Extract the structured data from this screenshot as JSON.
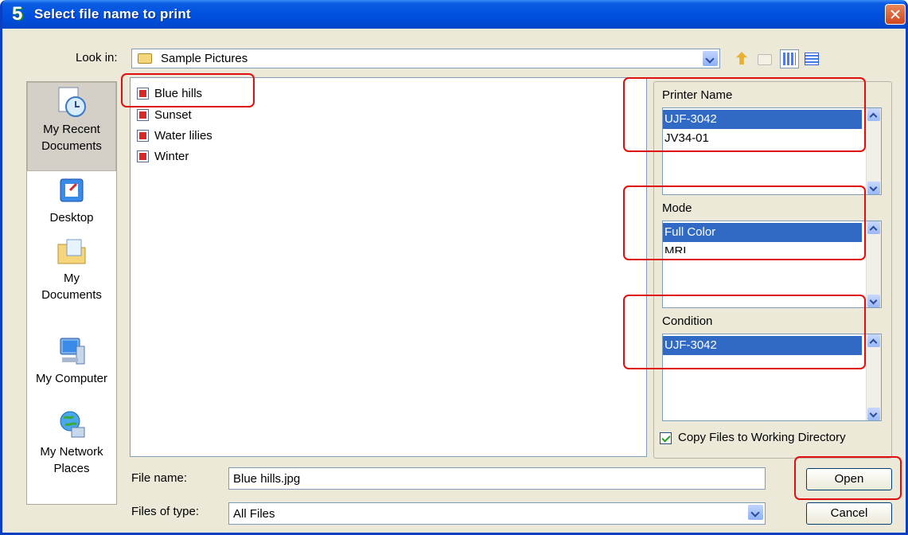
{
  "window": {
    "title": "Select file name to print",
    "app_icon": "5"
  },
  "lookin": {
    "label": "Look in:",
    "value": "Sample Pictures"
  },
  "toolbar": {
    "icons": [
      "up-folder-icon",
      "new-folder-icon",
      "list-view-icon",
      "details-view-icon"
    ]
  },
  "places": [
    {
      "label": "My Recent Documents",
      "line1": "My Recent",
      "line2": "Documents",
      "icon": "recent-documents-icon"
    },
    {
      "label": "Desktop",
      "line1": "Desktop",
      "line2": "",
      "icon": "desktop-icon"
    },
    {
      "label": "My Documents",
      "line1": "My",
      "line2": "Documents",
      "icon": "my-documents-icon"
    },
    {
      "label": "My Computer",
      "line1": "My Computer",
      "line2": "",
      "icon": "my-computer-icon"
    },
    {
      "label": "My Network Places",
      "line1": "My Network",
      "line2": "Places",
      "icon": "network-places-icon"
    }
  ],
  "files": [
    "Blue hills",
    "Sunset",
    "Water lilies",
    "Winter"
  ],
  "printer": {
    "label": "Printer Name",
    "items": [
      "UJF-3042",
      "JV34-01"
    ]
  },
  "mode": {
    "label": "Mode",
    "items": [
      "Full Color",
      "MRL"
    ]
  },
  "condition": {
    "label": "Condition",
    "items": [
      "UJF-3042"
    ]
  },
  "copy_files": {
    "label": "Copy Files to Working Directory",
    "checked": true
  },
  "filename": {
    "label": "File name:",
    "value": "Blue hills.jpg"
  },
  "filetype": {
    "label": "Files of type:",
    "value": "All Files"
  },
  "buttons": {
    "open": "Open",
    "cancel": "Cancel"
  }
}
